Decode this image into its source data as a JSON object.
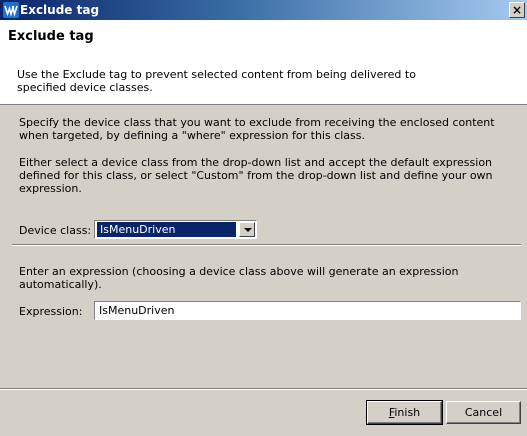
{
  "window": {
    "title": "Exclude tag",
    "close_glyph": "×",
    "app_icon": "websphere-w-icon"
  },
  "header": {
    "title": "Exclude tag",
    "description": "Use the Exclude tag to prevent selected content from being delivered to specified device classes."
  },
  "content": {
    "paragraph1": "Specify the device class that you want to exclude from receiving the enclosed content when targeted, by defining a \"where\" expression for this class.",
    "paragraph2": "Either select a device class from the drop-down list and accept the default expression defined for this class, or select \"Custom\" from the drop-down list and define your own expression.",
    "device_class_label": "Device class:",
    "device_class_value": "IsMenuDriven",
    "paragraph3": "Enter an expression (choosing a device class above will generate an expression automatically).",
    "expression_label": "Expression:",
    "expression_value": "IsMenuDriven"
  },
  "buttons": {
    "finish_mnemonic": "F",
    "finish_rest": "inish",
    "cancel": "Cancel"
  },
  "colors": {
    "titlebar_start": "#0a246a",
    "titlebar_end": "#a6caf0",
    "face": "#d4d0c8",
    "selection": "#0a246a"
  }
}
